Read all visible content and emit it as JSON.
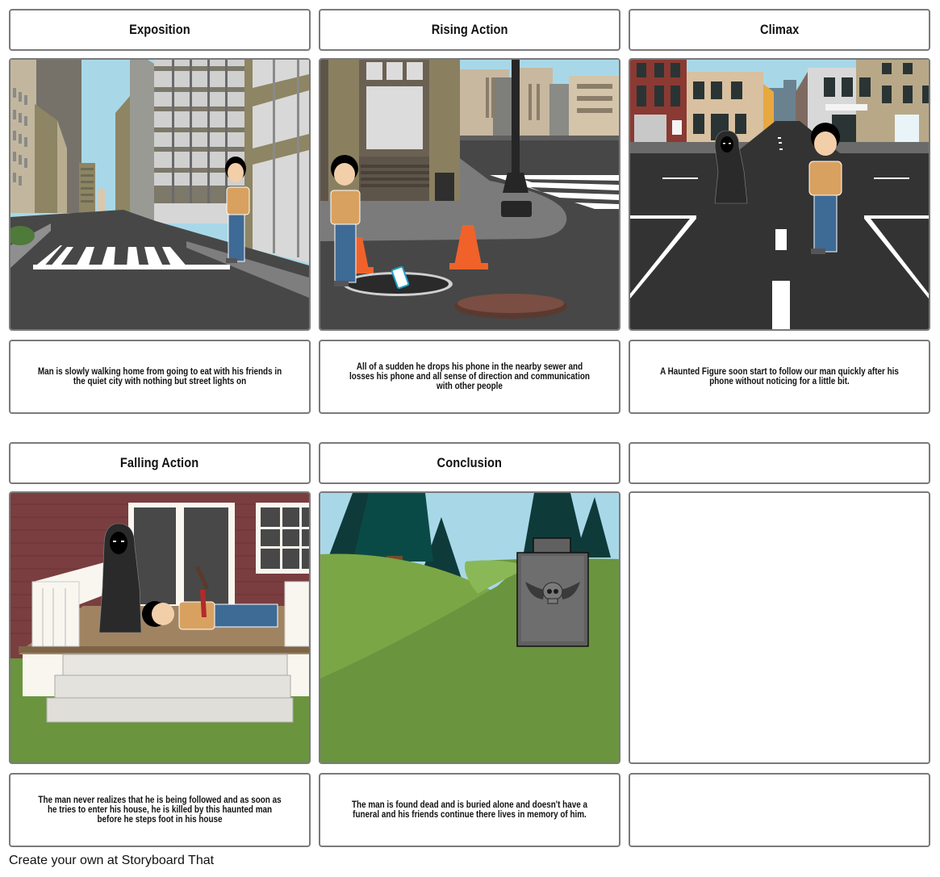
{
  "storyboard": {
    "cells": [
      {
        "title": "Exposition",
        "scene": "city-street-crosswalk",
        "description": "Man is slowly walking home from going to eat with his friends in the quiet city with nothing but street lights on"
      },
      {
        "title": "Rising Action",
        "scene": "street-corner-open-manhole",
        "description": "All of a sudden he drops his phone in the nearby sewer and losses his phone and all sense of direction and communication with other people"
      },
      {
        "title": "Climax",
        "scene": "intersection-hooded-figure",
        "description": "A Haunted Figure soon start to follow our man quickly after his phone without noticing for a little bit."
      },
      {
        "title": "Falling Action",
        "scene": "house-porch-hooded-figure",
        "description": "The man never realizes that he is being followed and as soon as he tries to enter his house, he is killed by this haunted man before he steps foot in his house"
      },
      {
        "title": "Conclusion",
        "scene": "hill-gravestone-skull",
        "description": "The man is found dead and is buried alone and doesn't have a funeral and his friends continue there lives in memory of him."
      },
      {
        "title": "",
        "scene": "empty",
        "description": ""
      }
    ]
  },
  "footer": {
    "text": "Create your own at Storyboard That"
  },
  "colors": {
    "border": "#7a7a7a",
    "sky": "#a8d8e8",
    "asphalt": "#474747",
    "grass": "#6a943e",
    "brick_house": "#7a3e40",
    "shirt": "#d9a160",
    "jeans": "#3e6a96",
    "cone": "#f0622a"
  }
}
